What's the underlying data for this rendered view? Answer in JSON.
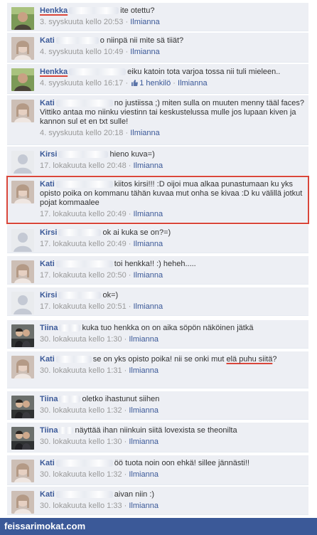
{
  "comments": [
    {
      "author": "Henkka",
      "underlined": true,
      "text": "ite otettu?",
      "time": "3. syyskuuta kello 20:53",
      "report": "Ilmianna",
      "avatar": "man-photo"
    },
    {
      "author": "Kati",
      "underlined": false,
      "text": "o niinpä nii mite sä tiiät?",
      "time": "4. syyskuuta kello 10:49",
      "report": "Ilmianna",
      "avatar": "woman-photo"
    },
    {
      "author": "Henkka",
      "underlined": true,
      "text": "eiku katoin tota varjoa tossa nii tuli mieleen..",
      "time": "4. syyskuuta kello 16:17",
      "likes": "1 henkilö",
      "report": "Ilmianna",
      "avatar": "man-photo"
    },
    {
      "author": "Kati",
      "underlined": false,
      "text": "no justiissa ;) miten sulla on muuten menny tääl faces? Vittiko antaa mo niinku viestinn tai keskustelussa mulle jos lupaan kiven ja kannon sul et en txt sulle!",
      "time": "4. syyskuuta kello 20:18",
      "report": "Ilmianna",
      "avatar": "woman-photo"
    },
    {
      "author": "Kirsi",
      "underlined": false,
      "text": "hieno kuva=)",
      "time": "17. lokakuuta kello 20:48",
      "report": "Ilmianna",
      "avatar": "silhouette"
    },
    {
      "author": "Kati",
      "underlined": false,
      "text": "kiitos kirsi!!! :D oijoi mua alkaa punastumaan ku yks opisto poika on kommanu tähän kuvaa mut onha se kivaa :D ku välillä jotkut pojat kommaalee",
      "time": "17. lokakuuta kello 20:49",
      "report": "Ilmianna",
      "avatar": "woman-photo",
      "highlight": true
    },
    {
      "author": "Kirsi",
      "underlined": false,
      "text": "ok ai kuka se on?=)",
      "time": "17. lokakuuta kello 20:49",
      "report": "Ilmianna",
      "avatar": "silhouette"
    },
    {
      "author": "Kati",
      "underlined": false,
      "text": "toi henkka!! :) heheh.....",
      "time": "17. lokakuuta kello 20:50",
      "report": "Ilmianna",
      "avatar": "woman-photo"
    },
    {
      "author": "Kirsi",
      "underlined": false,
      "text": "ok=)",
      "time": "17. lokakuuta kello 20:51",
      "report": "Ilmianna",
      "avatar": "silhouette"
    },
    {
      "author": "Tiina",
      "underlined": false,
      "text": "kuka tuo henkka on on aika söpön näköinen jätkä",
      "time": "30. lokakuuta kello 1:30",
      "report": "Ilmianna",
      "avatar": "pair-photo"
    },
    {
      "author": "Kati",
      "underlined": false,
      "text_before": "se on yks opisto poika! nii se onki mut ",
      "text_marked": "elä puhu siitä",
      "text_after": "?",
      "time": "30. lokakuuta kello 1:31",
      "report": "Ilmianna",
      "avatar": "woman-photo"
    },
    {
      "author": "Tiina",
      "underlined": false,
      "text": "oletko ihastunut siihen",
      "time": "30. lokakuuta kello 1:32",
      "report": "Ilmianna",
      "avatar": "pair-photo"
    },
    {
      "author": "Tiina",
      "underlined": false,
      "text": "näyttää ihan niinkuin siitä lovexista se theonilta",
      "time": "30. lokakuuta kello 1:30",
      "report": "Ilmianna",
      "avatar": "pair-photo"
    },
    {
      "author": "Kati",
      "underlined": false,
      "text": "öö tuota noin oon ehkä! sillee jännästi!!",
      "time": "30. lokakuuta kello 1:32",
      "report": "Ilmianna",
      "avatar": "woman-photo"
    },
    {
      "author": "Kati",
      "underlined": false,
      "text": "aivan niin :)",
      "time": "30. lokakuuta kello 1:33",
      "report": "Ilmianna",
      "avatar": "woman-photo"
    }
  ],
  "footer": {
    "site": "feissarimokat.com"
  },
  "colors": {
    "link": "#3b5998",
    "background": "#edeff4",
    "highlight_border": "#d9463a",
    "footer": "#3b5998"
  }
}
